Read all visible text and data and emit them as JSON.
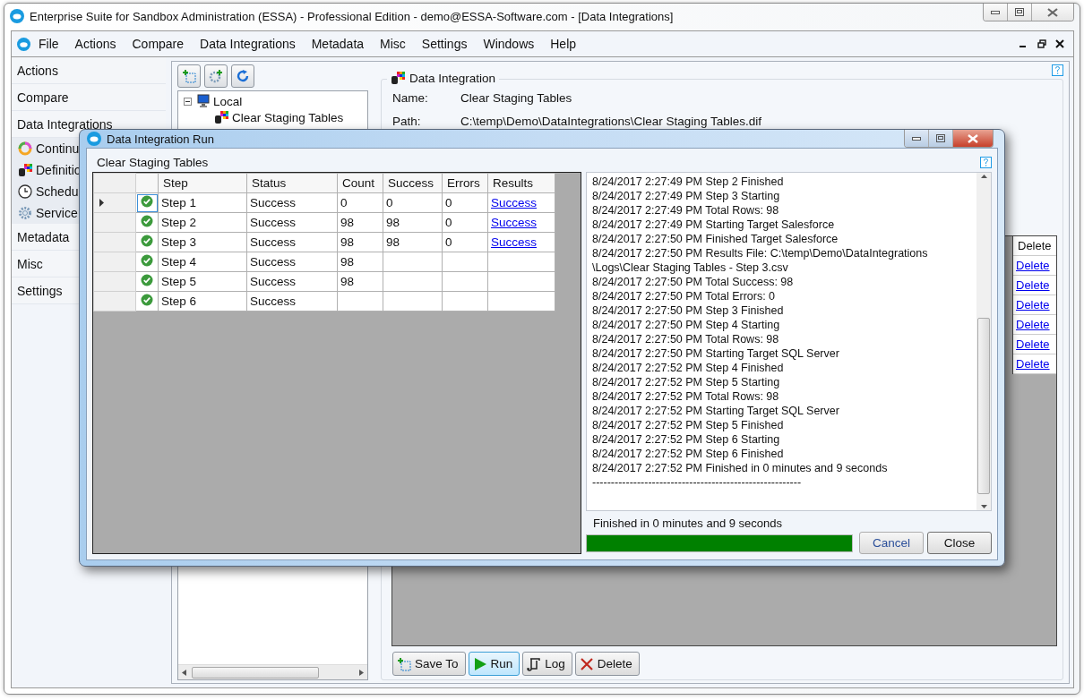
{
  "window": {
    "title": "Enterprise Suite for Sandbox Administration (ESSA) - Professional Edition - demo@ESSA-Software.com - [Data Integrations]"
  },
  "menu": [
    "File",
    "Actions",
    "Compare",
    "Data Integrations",
    "Metadata",
    "Misc",
    "Settings",
    "Windows",
    "Help"
  ],
  "sidebar": {
    "items": [
      {
        "label": "Actions"
      },
      {
        "label": "Compare"
      },
      {
        "label": "Data Integrations",
        "children": [
          {
            "label": "Continu",
            "kind": "ring"
          },
          {
            "label": "Definitio",
            "kind": "grid"
          },
          {
            "label": "Schedu",
            "kind": "clock"
          },
          {
            "label": "Service",
            "kind": "gear"
          }
        ]
      },
      {
        "label": "Metadata"
      },
      {
        "label": "Misc"
      },
      {
        "label": "Settings"
      }
    ]
  },
  "tree": {
    "items": [
      {
        "label": "Local",
        "expanded": true,
        "children": [
          {
            "label": "Clear Staging Tables"
          }
        ]
      }
    ]
  },
  "detail": {
    "title": "Data Integration",
    "fields": [
      {
        "label": "Name:",
        "value": "Clear Staging Tables"
      },
      {
        "label": "Path:",
        "value": "C:\\temp\\Demo\\DataIntegrations\\Clear Staging Tables.dif"
      }
    ],
    "grid": {
      "header": "Delete",
      "rows": [
        "Delete",
        "Delete",
        "Delete",
        "Delete",
        "Delete",
        "Delete"
      ]
    },
    "buttons": [
      {
        "label": "Save To",
        "kind": "save"
      },
      {
        "label": "Run",
        "kind": "run"
      },
      {
        "label": "Log",
        "kind": "log"
      },
      {
        "label": "Delete",
        "kind": "delete"
      }
    ]
  },
  "dialog": {
    "title": "Data Integration Run",
    "heading": "Clear Staging Tables",
    "columns": [
      "Step",
      "Status",
      "Count",
      "Success",
      "Errors",
      "Results"
    ],
    "rows": [
      {
        "step": "Step 1",
        "status": "Success",
        "count": "0",
        "success": "0",
        "errors": "0",
        "results": "Success",
        "selected": true
      },
      {
        "step": "Step 2",
        "status": "Success",
        "count": "98",
        "success": "98",
        "errors": "0",
        "results": "Success",
        "selected": false
      },
      {
        "step": "Step 3",
        "status": "Success",
        "count": "98",
        "success": "98",
        "errors": "0",
        "results": "Success",
        "selected": false
      },
      {
        "step": "Step 4",
        "status": "Success",
        "count": "98",
        "selected": false
      },
      {
        "step": "Step 5",
        "status": "Success",
        "count": "98",
        "selected": false
      },
      {
        "step": "Step 6",
        "status": "Success",
        "selected": false
      }
    ],
    "log": [
      "8/24/2017 2:27:49 PM Step 2 Finished",
      "8/24/2017 2:27:49 PM Step 3 Starting",
      "8/24/2017 2:27:49 PM Total Rows: 98",
      "8/24/2017 2:27:49 PM Starting Target Salesforce",
      "8/24/2017 2:27:50 PM Finished Target Salesforce",
      "8/24/2017 2:27:50 PM Results File: C:\\temp\\Demo\\DataIntegrations",
      "\\Logs\\Clear Staging Tables - Step 3.csv",
      "8/24/2017 2:27:50 PM Total Success: 98",
      "8/24/2017 2:27:50 PM Total Errors: 0",
      "8/24/2017 2:27:50 PM Step 3 Finished",
      "8/24/2017 2:27:50 PM Step 4 Starting",
      "8/24/2017 2:27:50 PM Total Rows: 98",
      "8/24/2017 2:27:50 PM Starting Target SQL Server",
      "8/24/2017 2:27:52 PM Step 4 Finished",
      "8/24/2017 2:27:52 PM Step 5 Starting",
      "8/24/2017 2:27:52 PM Total Rows: 98",
      "8/24/2017 2:27:52 PM Starting Target SQL Server",
      "8/24/2017 2:27:52 PM Step 5 Finished",
      "8/24/2017 2:27:52 PM Step 6 Starting",
      "8/24/2017 2:27:52 PM Step 6 Finished",
      "8/24/2017 2:27:52 PM Finished in 0 minutes and 9 seconds",
      "--------------------------------------------------------"
    ],
    "status": "Finished in 0 minutes and 9 seconds",
    "progress": {
      "level": 1
    },
    "buttons": [
      "Cancel",
      "Close"
    ]
  }
}
